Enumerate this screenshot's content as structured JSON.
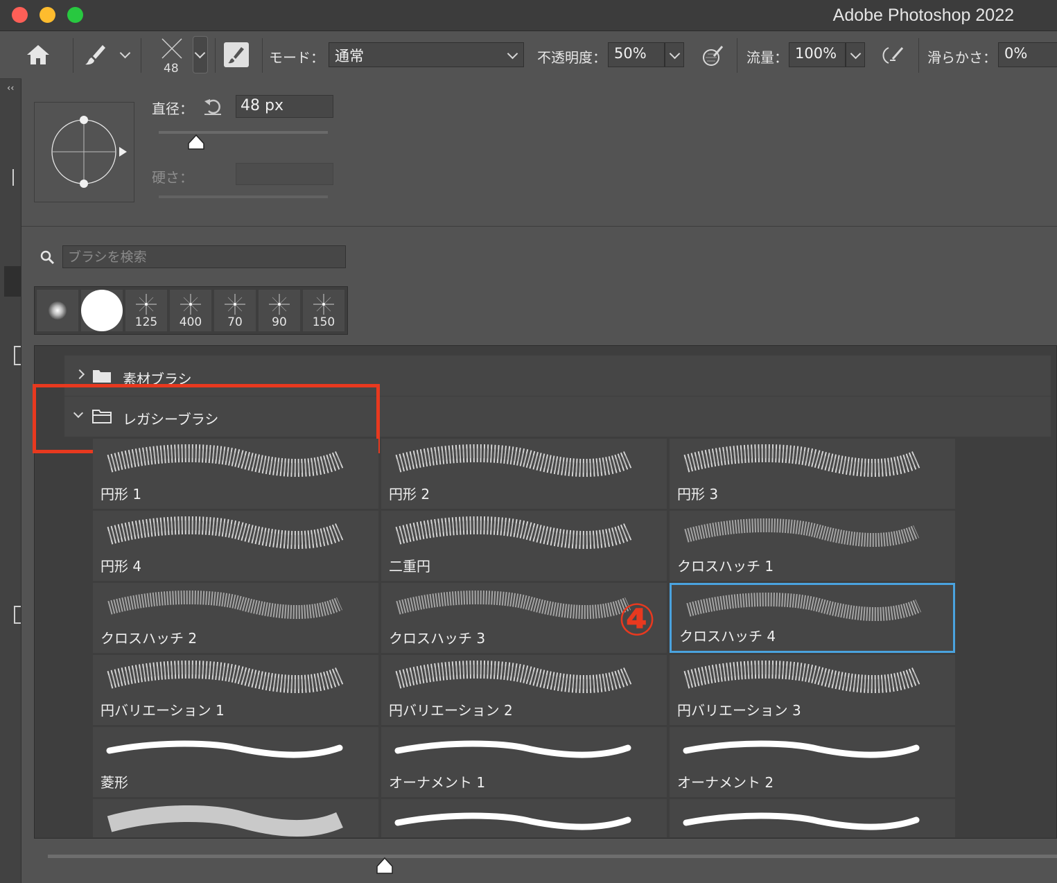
{
  "window": {
    "title": "Adobe Photoshop 2022"
  },
  "colors": {
    "red": "#fe5f57",
    "yellow": "#febc2e",
    "green": "#28c840",
    "annotation": "#e8391f",
    "selection": "#4aa3df"
  },
  "options_bar": {
    "brush_size": "48",
    "mode_label": "モード：",
    "mode_value": "通常",
    "opacity_label": "不透明度：",
    "opacity_value": "50%",
    "flow_label": "流量：",
    "flow_value": "100%",
    "smoothing_label": "滑らかさ：",
    "smoothing_value": "0%"
  },
  "brush_panel": {
    "diameter_label": "直径：",
    "diameter_value": "48 px",
    "hardness_label": "硬さ：",
    "search_placeholder": "ブラシを検索",
    "presets": [
      "125",
      "400",
      "70",
      "90",
      "150"
    ],
    "groups": [
      {
        "name": "素材ブラシ",
        "expanded": false
      },
      {
        "name": "レガシーブラシ",
        "expanded": true
      }
    ],
    "annotation": "④",
    "brushes": [
      "円形 1",
      "円形 2",
      "円形 3",
      "円形 4",
      "二重円",
      "クロスハッチ 1",
      "クロスハッチ 2",
      "クロスハッチ 3",
      "クロスハッチ 4",
      "円バリエーション 1",
      "円バリエーション 2",
      "円バリエーション 3",
      "菱形",
      "オーナメント 1",
      "オーナメント 2"
    ],
    "selected_brush": "クロスハッチ 4"
  }
}
